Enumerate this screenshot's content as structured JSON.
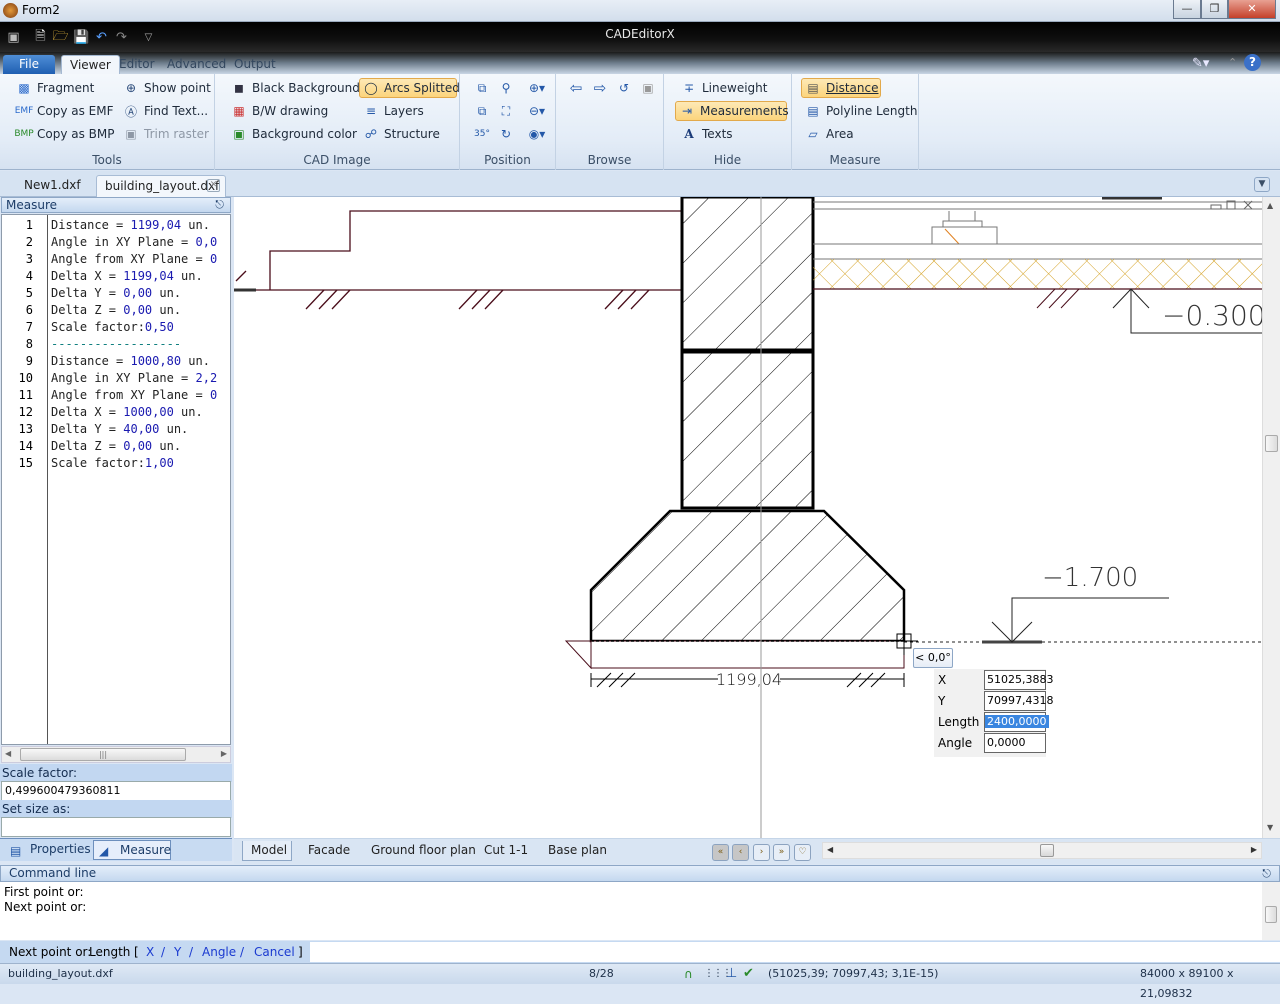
{
  "window": {
    "title": "Form2",
    "app_title": "CADEditorX"
  },
  "ribbon_tabs": [
    {
      "label": "File"
    },
    {
      "label": "Viewer"
    },
    {
      "label": "Editor"
    },
    {
      "label": "Advanced"
    },
    {
      "label": "Output"
    }
  ],
  "ribbon": {
    "tools": {
      "label": "Tools",
      "items": [
        "Fragment",
        "Copy as EMF",
        "Copy as BMP",
        "Show point",
        "Find Text...",
        "Trim raster"
      ]
    },
    "cad_image": {
      "label": "CAD Image",
      "items": [
        "Black Background",
        "B/W drawing",
        "Background color",
        "Arcs Splitted",
        "Layers",
        "Structure"
      ]
    },
    "position": {
      "label": "Position"
    },
    "browse": {
      "label": "Browse"
    },
    "hide": {
      "label": "Hide",
      "items": [
        "Lineweight",
        "Measurements",
        "Texts"
      ]
    },
    "measure": {
      "label": "Measure",
      "items": [
        "Distance",
        "Polyline Length",
        "Area"
      ]
    }
  },
  "doc_tabs": [
    {
      "label": "New1.dxf"
    },
    {
      "label": "building_layout.dxf"
    }
  ],
  "measure_panel": {
    "title": "Measure",
    "lines": [
      {
        "n": "1",
        "k": "Distance = ",
        "v": "1199,04",
        "s": " un."
      },
      {
        "n": "2",
        "k": "Angle in XY Plane = ",
        "v": "0,0",
        "s": ""
      },
      {
        "n": "3",
        "k": "Angle from XY Plane = ",
        "v": "0",
        "s": ""
      },
      {
        "n": "4",
        "k": "Delta X = ",
        "v": "1199,04",
        "s": " un."
      },
      {
        "n": "5",
        "k": "Delta Y = ",
        "v": "0,00",
        "s": " un."
      },
      {
        "n": "6",
        "k": "Delta Z = ",
        "v": "0,00",
        "s": " un."
      },
      {
        "n": "7",
        "k": "Scale factor:",
        "v": "0,50",
        "s": ""
      },
      {
        "n": "8",
        "k": "",
        "v": "",
        "s": "------------------"
      },
      {
        "n": "9",
        "k": "Distance = ",
        "v": "1000,80",
        "s": " un."
      },
      {
        "n": "10",
        "k": "Angle in XY Plane = ",
        "v": "2,2",
        "s": ""
      },
      {
        "n": "11",
        "k": "Angle from XY Plane = ",
        "v": "0",
        "s": ""
      },
      {
        "n": "12",
        "k": "Delta X = ",
        "v": "1000,00",
        "s": " un."
      },
      {
        "n": "13",
        "k": "Delta Y = ",
        "v": "40,00",
        "s": " un."
      },
      {
        "n": "14",
        "k": "Delta Z = ",
        "v": "0,00",
        "s": " un."
      },
      {
        "n": "15",
        "k": "Scale factor:",
        "v": "1,00",
        "s": ""
      }
    ],
    "scale_factor_label": "Scale factor:",
    "scale_factor_value": "0,499600479360811",
    "set_size_label": "Set size as:",
    "set_size_value": ""
  },
  "panel_tabs": [
    {
      "label": "Properties"
    },
    {
      "label": "Measure"
    }
  ],
  "drawing": {
    "dimension_text": "1199,04",
    "level_top": "−0.300",
    "level_bottom": "−1.700"
  },
  "snap_popup": {
    "angle_tip": "< 0,0°",
    "fields": [
      {
        "label": "X",
        "value": "51025,3883"
      },
      {
        "label": "Y",
        "value": "70997,4318"
      },
      {
        "label": "Length",
        "value": "2400,0000"
      },
      {
        "label": "Angle",
        "value": "0,0000"
      }
    ]
  },
  "layout_tabs": [
    {
      "label": "Model"
    },
    {
      "label": "Facade"
    },
    {
      "label": "Ground floor plan"
    },
    {
      "label": "Cut 1-1"
    },
    {
      "label": "Base plan"
    }
  ],
  "command_line": {
    "title": "Command line",
    "history": [
      "First point or:",
      "Next point or:"
    ],
    "prompt": "Next point or:",
    "prompt_length": "Length",
    "options": [
      "X",
      "Y",
      "Angle",
      "Cancel"
    ],
    "input_value": ""
  },
  "status_bar": {
    "file": "building_layout.dxf",
    "page": "8/28",
    "coords": "(51025,39; 70997,43; 3,1E-15)",
    "extents": "84000 x 89100 x 21,09832"
  }
}
